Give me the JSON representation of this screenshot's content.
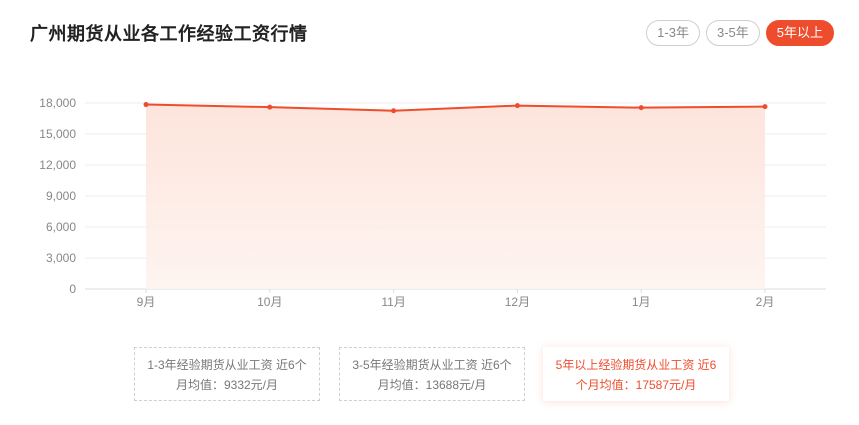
{
  "title": "广州期货从业各工作经验工资行情",
  "tabs": [
    {
      "label": "1-3年",
      "active": false
    },
    {
      "label": "3-5年",
      "active": false
    },
    {
      "label": "5年以上",
      "active": true
    }
  ],
  "colors": {
    "accent": "#ee4d2d",
    "area": "#fde3da"
  },
  "chart_data": {
    "type": "area",
    "categories": [
      "9月",
      "10月",
      "11月",
      "12月",
      "1月",
      "2月"
    ],
    "values": [
      17850,
      17600,
      17250,
      17750,
      17550,
      17650
    ],
    "yticks": [
      0,
      3000,
      6000,
      9000,
      12000,
      15000,
      18000
    ],
    "ytick_labels": [
      "0",
      "3,000",
      "6,000",
      "9,000",
      "12,000",
      "15,000",
      "18,000"
    ],
    "ylim": [
      0,
      18000
    ],
    "grid": true
  },
  "cards": [
    {
      "line1": "1-3年经验期货从业工资 近6个",
      "line2": "月均值：9332元/月",
      "active": false
    },
    {
      "line1": "3-5年经验期货从业工资 近6个",
      "line2": "月均值：13688元/月",
      "active": false
    },
    {
      "line1": "5年以上经验期货从业工资 近6",
      "line2": "个月均值：17587元/月",
      "active": true
    }
  ]
}
